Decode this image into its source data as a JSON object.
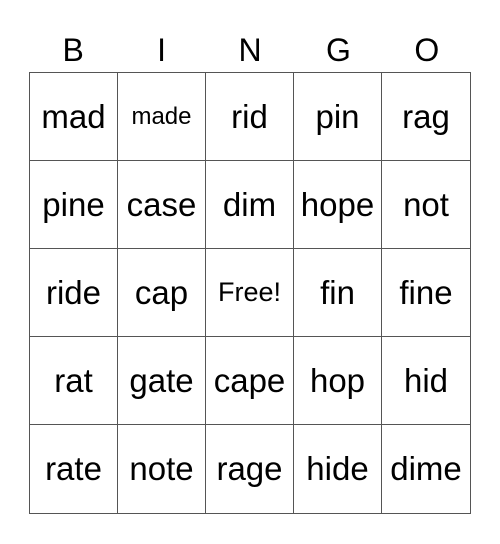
{
  "header": {
    "letters": [
      "B",
      "I",
      "N",
      "G",
      "O"
    ]
  },
  "board": {
    "cells": [
      [
        "mad",
        "made",
        "rid",
        "pin",
        "rag"
      ],
      [
        "pine",
        "case",
        "dim",
        "hope",
        "not"
      ],
      [
        "ride",
        "cap",
        "Free!",
        "fin",
        "fine"
      ],
      [
        "rat",
        "gate",
        "cape",
        "hop",
        "hid"
      ],
      [
        "rate",
        "note",
        "rage",
        "hide",
        "dime"
      ]
    ],
    "free_space": "Free!"
  }
}
